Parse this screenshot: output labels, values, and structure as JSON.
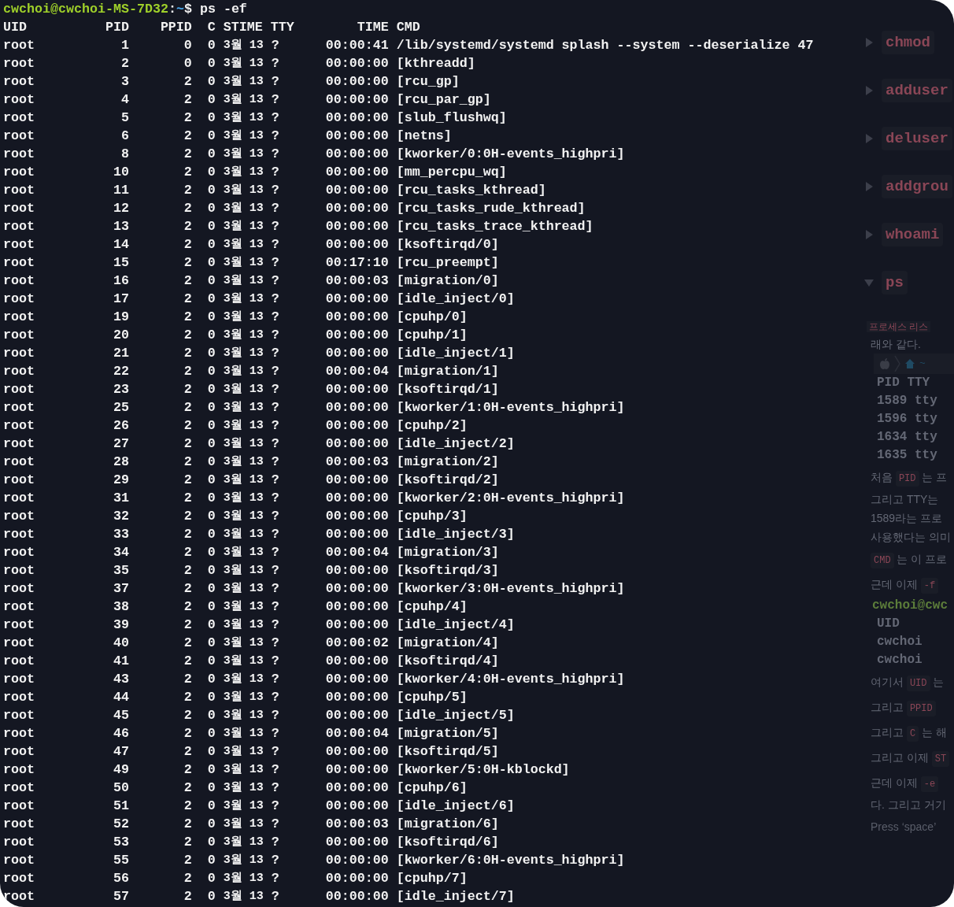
{
  "prompt": {
    "user_host": "cwchoi@cwchoi-MS-7D32",
    "separator": ":",
    "path": "~",
    "symbol": "$",
    "command": "ps -ef"
  },
  "columns": [
    "UID",
    "PID",
    "PPID",
    "C",
    "STIME",
    "TTY",
    "TIME",
    "CMD"
  ],
  "processes": [
    {
      "uid": "root",
      "pid": "1",
      "ppid": "0",
      "c": "0",
      "stime": "3월 13",
      "tty": "?",
      "time": "00:00:41",
      "cmd": "/lib/systemd/systemd splash --system --deserialize 47"
    },
    {
      "uid": "root",
      "pid": "2",
      "ppid": "0",
      "c": "0",
      "stime": "3월 13",
      "tty": "?",
      "time": "00:00:00",
      "cmd": "[kthreadd]"
    },
    {
      "uid": "root",
      "pid": "3",
      "ppid": "2",
      "c": "0",
      "stime": "3월 13",
      "tty": "?",
      "time": "00:00:00",
      "cmd": "[rcu_gp]"
    },
    {
      "uid": "root",
      "pid": "4",
      "ppid": "2",
      "c": "0",
      "stime": "3월 13",
      "tty": "?",
      "time": "00:00:00",
      "cmd": "[rcu_par_gp]"
    },
    {
      "uid": "root",
      "pid": "5",
      "ppid": "2",
      "c": "0",
      "stime": "3월 13",
      "tty": "?",
      "time": "00:00:00",
      "cmd": "[slub_flushwq]"
    },
    {
      "uid": "root",
      "pid": "6",
      "ppid": "2",
      "c": "0",
      "stime": "3월 13",
      "tty": "?",
      "time": "00:00:00",
      "cmd": "[netns]"
    },
    {
      "uid": "root",
      "pid": "8",
      "ppid": "2",
      "c": "0",
      "stime": "3월 13",
      "tty": "?",
      "time": "00:00:00",
      "cmd": "[kworker/0:0H-events_highpri]"
    },
    {
      "uid": "root",
      "pid": "10",
      "ppid": "2",
      "c": "0",
      "stime": "3월 13",
      "tty": "?",
      "time": "00:00:00",
      "cmd": "[mm_percpu_wq]"
    },
    {
      "uid": "root",
      "pid": "11",
      "ppid": "2",
      "c": "0",
      "stime": "3월 13",
      "tty": "?",
      "time": "00:00:00",
      "cmd": "[rcu_tasks_kthread]"
    },
    {
      "uid": "root",
      "pid": "12",
      "ppid": "2",
      "c": "0",
      "stime": "3월 13",
      "tty": "?",
      "time": "00:00:00",
      "cmd": "[rcu_tasks_rude_kthread]"
    },
    {
      "uid": "root",
      "pid": "13",
      "ppid": "2",
      "c": "0",
      "stime": "3월 13",
      "tty": "?",
      "time": "00:00:00",
      "cmd": "[rcu_tasks_trace_kthread]"
    },
    {
      "uid": "root",
      "pid": "14",
      "ppid": "2",
      "c": "0",
      "stime": "3월 13",
      "tty": "?",
      "time": "00:00:00",
      "cmd": "[ksoftirqd/0]"
    },
    {
      "uid": "root",
      "pid": "15",
      "ppid": "2",
      "c": "0",
      "stime": "3월 13",
      "tty": "?",
      "time": "00:17:10",
      "cmd": "[rcu_preempt]"
    },
    {
      "uid": "root",
      "pid": "16",
      "ppid": "2",
      "c": "0",
      "stime": "3월 13",
      "tty": "?",
      "time": "00:00:03",
      "cmd": "[migration/0]"
    },
    {
      "uid": "root",
      "pid": "17",
      "ppid": "2",
      "c": "0",
      "stime": "3월 13",
      "tty": "?",
      "time": "00:00:00",
      "cmd": "[idle_inject/0]"
    },
    {
      "uid": "root",
      "pid": "19",
      "ppid": "2",
      "c": "0",
      "stime": "3월 13",
      "tty": "?",
      "time": "00:00:00",
      "cmd": "[cpuhp/0]"
    },
    {
      "uid": "root",
      "pid": "20",
      "ppid": "2",
      "c": "0",
      "stime": "3월 13",
      "tty": "?",
      "time": "00:00:00",
      "cmd": "[cpuhp/1]"
    },
    {
      "uid": "root",
      "pid": "21",
      "ppid": "2",
      "c": "0",
      "stime": "3월 13",
      "tty": "?",
      "time": "00:00:00",
      "cmd": "[idle_inject/1]"
    },
    {
      "uid": "root",
      "pid": "22",
      "ppid": "2",
      "c": "0",
      "stime": "3월 13",
      "tty": "?",
      "time": "00:00:04",
      "cmd": "[migration/1]"
    },
    {
      "uid": "root",
      "pid": "23",
      "ppid": "2",
      "c": "0",
      "stime": "3월 13",
      "tty": "?",
      "time": "00:00:00",
      "cmd": "[ksoftirqd/1]"
    },
    {
      "uid": "root",
      "pid": "25",
      "ppid": "2",
      "c": "0",
      "stime": "3월 13",
      "tty": "?",
      "time": "00:00:00",
      "cmd": "[kworker/1:0H-events_highpri]"
    },
    {
      "uid": "root",
      "pid": "26",
      "ppid": "2",
      "c": "0",
      "stime": "3월 13",
      "tty": "?",
      "time": "00:00:00",
      "cmd": "[cpuhp/2]"
    },
    {
      "uid": "root",
      "pid": "27",
      "ppid": "2",
      "c": "0",
      "stime": "3월 13",
      "tty": "?",
      "time": "00:00:00",
      "cmd": "[idle_inject/2]"
    },
    {
      "uid": "root",
      "pid": "28",
      "ppid": "2",
      "c": "0",
      "stime": "3월 13",
      "tty": "?",
      "time": "00:00:03",
      "cmd": "[migration/2]"
    },
    {
      "uid": "root",
      "pid": "29",
      "ppid": "2",
      "c": "0",
      "stime": "3월 13",
      "tty": "?",
      "time": "00:00:00",
      "cmd": "[ksoftirqd/2]"
    },
    {
      "uid": "root",
      "pid": "31",
      "ppid": "2",
      "c": "0",
      "stime": "3월 13",
      "tty": "?",
      "time": "00:00:00",
      "cmd": "[kworker/2:0H-events_highpri]"
    },
    {
      "uid": "root",
      "pid": "32",
      "ppid": "2",
      "c": "0",
      "stime": "3월 13",
      "tty": "?",
      "time": "00:00:00",
      "cmd": "[cpuhp/3]"
    },
    {
      "uid": "root",
      "pid": "33",
      "ppid": "2",
      "c": "0",
      "stime": "3월 13",
      "tty": "?",
      "time": "00:00:00",
      "cmd": "[idle_inject/3]"
    },
    {
      "uid": "root",
      "pid": "34",
      "ppid": "2",
      "c": "0",
      "stime": "3월 13",
      "tty": "?",
      "time": "00:00:04",
      "cmd": "[migration/3]"
    },
    {
      "uid": "root",
      "pid": "35",
      "ppid": "2",
      "c": "0",
      "stime": "3월 13",
      "tty": "?",
      "time": "00:00:00",
      "cmd": "[ksoftirqd/3]"
    },
    {
      "uid": "root",
      "pid": "37",
      "ppid": "2",
      "c": "0",
      "stime": "3월 13",
      "tty": "?",
      "time": "00:00:00",
      "cmd": "[kworker/3:0H-events_highpri]"
    },
    {
      "uid": "root",
      "pid": "38",
      "ppid": "2",
      "c": "0",
      "stime": "3월 13",
      "tty": "?",
      "time": "00:00:00",
      "cmd": "[cpuhp/4]"
    },
    {
      "uid": "root",
      "pid": "39",
      "ppid": "2",
      "c": "0",
      "stime": "3월 13",
      "tty": "?",
      "time": "00:00:00",
      "cmd": "[idle_inject/4]"
    },
    {
      "uid": "root",
      "pid": "40",
      "ppid": "2",
      "c": "0",
      "stime": "3월 13",
      "tty": "?",
      "time": "00:00:02",
      "cmd": "[migration/4]"
    },
    {
      "uid": "root",
      "pid": "41",
      "ppid": "2",
      "c": "0",
      "stime": "3월 13",
      "tty": "?",
      "time": "00:00:00",
      "cmd": "[ksoftirqd/4]"
    },
    {
      "uid": "root",
      "pid": "43",
      "ppid": "2",
      "c": "0",
      "stime": "3월 13",
      "tty": "?",
      "time": "00:00:00",
      "cmd": "[kworker/4:0H-events_highpri]"
    },
    {
      "uid": "root",
      "pid": "44",
      "ppid": "2",
      "c": "0",
      "stime": "3월 13",
      "tty": "?",
      "time": "00:00:00",
      "cmd": "[cpuhp/5]"
    },
    {
      "uid": "root",
      "pid": "45",
      "ppid": "2",
      "c": "0",
      "stime": "3월 13",
      "tty": "?",
      "time": "00:00:00",
      "cmd": "[idle_inject/5]"
    },
    {
      "uid": "root",
      "pid": "46",
      "ppid": "2",
      "c": "0",
      "stime": "3월 13",
      "tty": "?",
      "time": "00:00:04",
      "cmd": "[migration/5]"
    },
    {
      "uid": "root",
      "pid": "47",
      "ppid": "2",
      "c": "0",
      "stime": "3월 13",
      "tty": "?",
      "time": "00:00:00",
      "cmd": "[ksoftirqd/5]"
    },
    {
      "uid": "root",
      "pid": "49",
      "ppid": "2",
      "c": "0",
      "stime": "3월 13",
      "tty": "?",
      "time": "00:00:00",
      "cmd": "[kworker/5:0H-kblockd]"
    },
    {
      "uid": "root",
      "pid": "50",
      "ppid": "2",
      "c": "0",
      "stime": "3월 13",
      "tty": "?",
      "time": "00:00:00",
      "cmd": "[cpuhp/6]"
    },
    {
      "uid": "root",
      "pid": "51",
      "ppid": "2",
      "c": "0",
      "stime": "3월 13",
      "tty": "?",
      "time": "00:00:00",
      "cmd": "[idle_inject/6]"
    },
    {
      "uid": "root",
      "pid": "52",
      "ppid": "2",
      "c": "0",
      "stime": "3월 13",
      "tty": "?",
      "time": "00:00:03",
      "cmd": "[migration/6]"
    },
    {
      "uid": "root",
      "pid": "53",
      "ppid": "2",
      "c": "0",
      "stime": "3월 13",
      "tty": "?",
      "time": "00:00:00",
      "cmd": "[ksoftirqd/6]"
    },
    {
      "uid": "root",
      "pid": "55",
      "ppid": "2",
      "c": "0",
      "stime": "3월 13",
      "tty": "?",
      "time": "00:00:00",
      "cmd": "[kworker/6:0H-events_highpri]"
    },
    {
      "uid": "root",
      "pid": "56",
      "ppid": "2",
      "c": "0",
      "stime": "3월 13",
      "tty": "?",
      "time": "00:00:00",
      "cmd": "[cpuhp/7]"
    },
    {
      "uid": "root",
      "pid": "57",
      "ppid": "2",
      "c": "0",
      "stime": "3월 13",
      "tty": "?",
      "time": "00:00:00",
      "cmd": "[idle_inject/7]"
    }
  ],
  "background_page": {
    "blocks": [
      {
        "kind": "toggle",
        "label": "chmod",
        "expanded": false
      },
      {
        "kind": "toggle",
        "label": "adduser",
        "expanded": false
      },
      {
        "kind": "toggle",
        "label": "deluser",
        "expanded": false
      },
      {
        "kind": "toggle",
        "label": "addgrou",
        "expanded": false
      },
      {
        "kind": "toggle",
        "label": "whoami",
        "expanded": false
      },
      {
        "kind": "toggle",
        "label": "ps",
        "expanded": true
      },
      {
        "kind": "caption",
        "text": "프로세스 리스"
      },
      {
        "kind": "text",
        "text": "래와 같다."
      },
      {
        "kind": "code_toolbar",
        "path": "~"
      },
      {
        "kind": "code_line",
        "text": "PID TTY"
      },
      {
        "kind": "code_line",
        "text": "1589 tty"
      },
      {
        "kind": "code_line",
        "text": "1596 tty"
      },
      {
        "kind": "code_line",
        "text": "1634 tty"
      },
      {
        "kind": "code_line",
        "text": "1635 tty"
      },
      {
        "kind": "para",
        "parts": [
          {
            "text": "처음 ",
            "code": false
          },
          {
            "text": "PID",
            "code": true
          },
          {
            "text": " 는 프",
            "code": false
          }
        ]
      },
      {
        "kind": "text",
        "text": "그리고 TTY는"
      },
      {
        "kind": "text",
        "text": "1589라는 프로"
      },
      {
        "kind": "text",
        "text": "사용했다는 의미"
      },
      {
        "kind": "para",
        "parts": [
          {
            "text": "CMD",
            "code": true
          },
          {
            "text": " 는 이 프로",
            "code": false
          }
        ]
      },
      {
        "kind": "para",
        "parts": [
          {
            "text": "근데 이제 ",
            "code": false
          },
          {
            "text": "-f",
            "code": true
          }
        ]
      },
      {
        "kind": "prompt_line",
        "text": "cwchoi@cwc"
      },
      {
        "kind": "code_line",
        "text": "UID"
      },
      {
        "kind": "code_line",
        "text": "cwchoi"
      },
      {
        "kind": "code_line",
        "text": "cwchoi"
      },
      {
        "kind": "para",
        "parts": [
          {
            "text": "여기서 ",
            "code": false
          },
          {
            "text": "UID",
            "code": true
          },
          {
            "text": " 는",
            "code": false
          }
        ]
      },
      {
        "kind": "para",
        "parts": [
          {
            "text": "그리고 ",
            "code": false
          },
          {
            "text": "PPID",
            "code": true
          }
        ]
      },
      {
        "kind": "para",
        "parts": [
          {
            "text": "그리고 ",
            "code": false
          },
          {
            "text": "C",
            "code": true
          },
          {
            "text": " 는 해",
            "code": false
          }
        ]
      },
      {
        "kind": "para",
        "parts": [
          {
            "text": "그리고 이제 ",
            "code": false
          },
          {
            "text": "ST",
            "code": true
          }
        ]
      },
      {
        "kind": "para",
        "parts": [
          {
            "text": "근데 이제 ",
            "code": false
          },
          {
            "text": "-e",
            "code": true
          }
        ]
      },
      {
        "kind": "text",
        "text": "다. 그리고 거기"
      },
      {
        "kind": "hint",
        "text": "Press ‘space’"
      }
    ]
  }
}
